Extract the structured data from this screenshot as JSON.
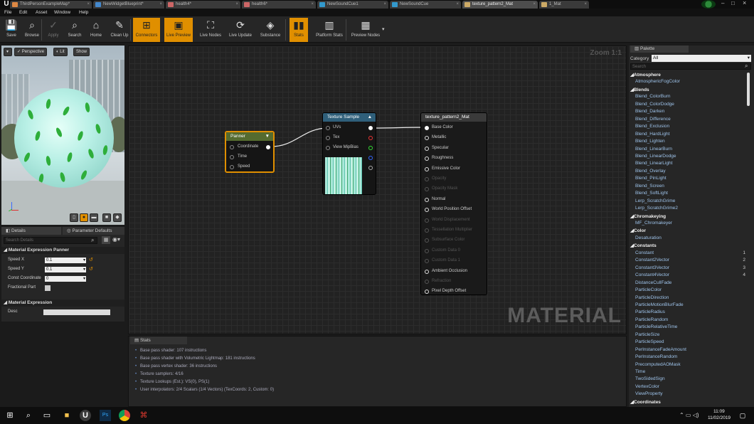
{
  "window": {
    "tabs": [
      {
        "label": "ThirdPersonExampleMap*",
        "active": false
      },
      {
        "label": "NewWidgetBlueprint*",
        "active": false
      },
      {
        "label": "health4*",
        "active": false
      },
      {
        "label": "health6*",
        "active": false
      },
      {
        "label": "NewSoundCue1",
        "active": false
      },
      {
        "label": "NewSoundCue",
        "active": false
      },
      {
        "label": "texture_pattern2_Mat",
        "active": true
      },
      {
        "label": "1_Mat",
        "active": false
      }
    ],
    "controls": {
      "minimize": "–",
      "maximize": "□",
      "close": "×"
    },
    "logo": "U"
  },
  "menu": [
    "File",
    "Edit",
    "Asset",
    "Window",
    "Help"
  ],
  "toolbar": [
    {
      "label": "Save",
      "icon": "save-icon",
      "state": "normal"
    },
    {
      "label": "Browse",
      "icon": "browse-icon",
      "state": "normal"
    },
    {
      "label": "Apply",
      "icon": "apply-icon",
      "state": "disabled"
    },
    {
      "label": "Search",
      "icon": "search-icon",
      "state": "normal"
    },
    {
      "label": "Home",
      "icon": "home-icon",
      "state": "normal"
    },
    {
      "label": "Clean Up",
      "icon": "cleanup-icon",
      "state": "normal"
    },
    {
      "label": "Connectors",
      "icon": "connectors-icon",
      "state": "active"
    },
    {
      "label": "Live Preview",
      "icon": "live-preview-icon",
      "state": "active"
    },
    {
      "label": "Live Nodes",
      "icon": "live-nodes-icon",
      "state": "normal"
    },
    {
      "label": "Live Update",
      "icon": "live-update-icon",
      "state": "normal"
    },
    {
      "label": "Substance",
      "icon": "substance-icon",
      "state": "normal"
    },
    {
      "label": "Stats",
      "icon": "stats-icon",
      "state": "active"
    },
    {
      "label": "Platform Stats",
      "icon": "platform-stats-icon",
      "state": "normal"
    },
    {
      "label": "Preview Nodes",
      "icon": "preview-nodes-icon",
      "state": "normal"
    }
  ],
  "viewport": {
    "perspective": "Perspective",
    "lit": "Lit",
    "show": "Show"
  },
  "details": {
    "tab_details": "Details",
    "tab_params": "Parameter Defaults",
    "search_placeholder": "Search Details",
    "section_panner": "Material Expression Panner",
    "rows": [
      {
        "label": "Speed X",
        "value": "0.1"
      },
      {
        "label": "Speed Y",
        "value": "0.1"
      },
      {
        "label": "Const Coordinate",
        "value": "0"
      },
      {
        "label": "Fractional Part",
        "value": ""
      }
    ],
    "section_expr": "Material Expression",
    "desc_label": "Desc",
    "desc_value": ""
  },
  "graph": {
    "zoom": "Zoom 1:1",
    "watermark": "MATERIAL",
    "panner": {
      "title": "Panner",
      "inputs": [
        "Coordinate",
        "Time",
        "Speed"
      ]
    },
    "texture_sample": {
      "title": "Texture Sample",
      "inputs": [
        "UVs",
        "Tex",
        "View MipBias"
      ]
    },
    "result": {
      "title": "texture_pattern2_Mat",
      "pins": [
        {
          "label": "Base Color",
          "enabled": true
        },
        {
          "label": "Metallic",
          "enabled": true
        },
        {
          "label": "Specular",
          "enabled": true
        },
        {
          "label": "Roughness",
          "enabled": true
        },
        {
          "label": "Emissive Color",
          "enabled": true
        },
        {
          "label": "Opacity",
          "enabled": false
        },
        {
          "label": "Opacity Mask",
          "enabled": false
        },
        {
          "label": "Normal",
          "enabled": true
        },
        {
          "label": "World Position Offset",
          "enabled": true
        },
        {
          "label": "World Displacement",
          "enabled": false
        },
        {
          "label": "Tessellation Multiplier",
          "enabled": false
        },
        {
          "label": "Subsurface Color",
          "enabled": false
        },
        {
          "label": "Custom Data 0",
          "enabled": false
        },
        {
          "label": "Custom Data 1",
          "enabled": false
        },
        {
          "label": "Ambient Occlusion",
          "enabled": true
        },
        {
          "label": "Refraction",
          "enabled": false
        },
        {
          "label": "Pixel Depth Offset",
          "enabled": true
        }
      ]
    }
  },
  "stats": {
    "tab": "Stats",
    "lines": [
      "Base pass shader: 107 instructions",
      "Base pass shader with Volumetric Lightmap: 181 instructions",
      "Base pass vertex shader: 36 instructions",
      "Texture samplers: 4/16",
      "Texture Lookups (Est.): VS(0), PS(1)",
      "User interpolators: 2/4 Scalars (1/4 Vectors) (TexCoords: 2, Custom: 0)"
    ]
  },
  "palette": {
    "tab": "Palette",
    "category_label": "Category",
    "category_value": "All",
    "search_placeholder": "Search",
    "entries": [
      {
        "text": "Atmosphere",
        "cat": true
      },
      {
        "text": "AtmosphericFogColor"
      },
      {
        "text": "Blends",
        "cat": true
      },
      {
        "text": "Blend_ColorBurn"
      },
      {
        "text": "Blend_ColorDodge"
      },
      {
        "text": "Blend_Darken"
      },
      {
        "text": "Blend_Difference"
      },
      {
        "text": "Blend_Exclusion"
      },
      {
        "text": "Blend_HardLight"
      },
      {
        "text": "Blend_Lighten"
      },
      {
        "text": "Blend_LinearBurn"
      },
      {
        "text": "Blend_LinearDodge"
      },
      {
        "text": "Blend_LinearLight"
      },
      {
        "text": "Blend_Overlay"
      },
      {
        "text": "Blend_PinLight"
      },
      {
        "text": "Blend_Screen"
      },
      {
        "text": "Blend_SoftLight"
      },
      {
        "text": "Lerp_ScratchGrime"
      },
      {
        "text": "Lerp_ScratchGrime2"
      },
      {
        "text": "Chromakeying",
        "cat": true
      },
      {
        "text": "MF_Chromakeyer"
      },
      {
        "text": "Color",
        "cat": true
      },
      {
        "text": "Desaturation"
      },
      {
        "text": "Constants",
        "cat": true
      },
      {
        "text": "Constant",
        "num": "1"
      },
      {
        "text": "Constant2Vector",
        "num": "2"
      },
      {
        "text": "Constant3Vector",
        "num": "3"
      },
      {
        "text": "Constant4Vector",
        "num": "4"
      },
      {
        "text": "DistanceCullFade"
      },
      {
        "text": "ParticleColor"
      },
      {
        "text": "ParticleDirection"
      },
      {
        "text": "ParticleMotionBlurFade"
      },
      {
        "text": "ParticleRadius"
      },
      {
        "text": "ParticleRandom"
      },
      {
        "text": "ParticleRelativeTime"
      },
      {
        "text": "ParticleSize"
      },
      {
        "text": "ParticleSpeed"
      },
      {
        "text": "PerInstanceFadeAmount"
      },
      {
        "text": "PerInstanceRandom"
      },
      {
        "text": "PrecomputedAOMask"
      },
      {
        "text": "Time"
      },
      {
        "text": "TwoSidedSign"
      },
      {
        "text": "VertexColor"
      },
      {
        "text": "ViewProperty"
      },
      {
        "text": "Coordinates",
        "cat": true
      }
    ]
  },
  "taskbar": {
    "time": "11:09",
    "date": "11/02/2019"
  },
  "colors": {
    "accent": "#e08f00",
    "node_panner_header": "#556b2f",
    "node_texture_header": "#2f5f7a",
    "node_result_header": "#3a3a3a",
    "palette_text": "#9ec3ea"
  }
}
